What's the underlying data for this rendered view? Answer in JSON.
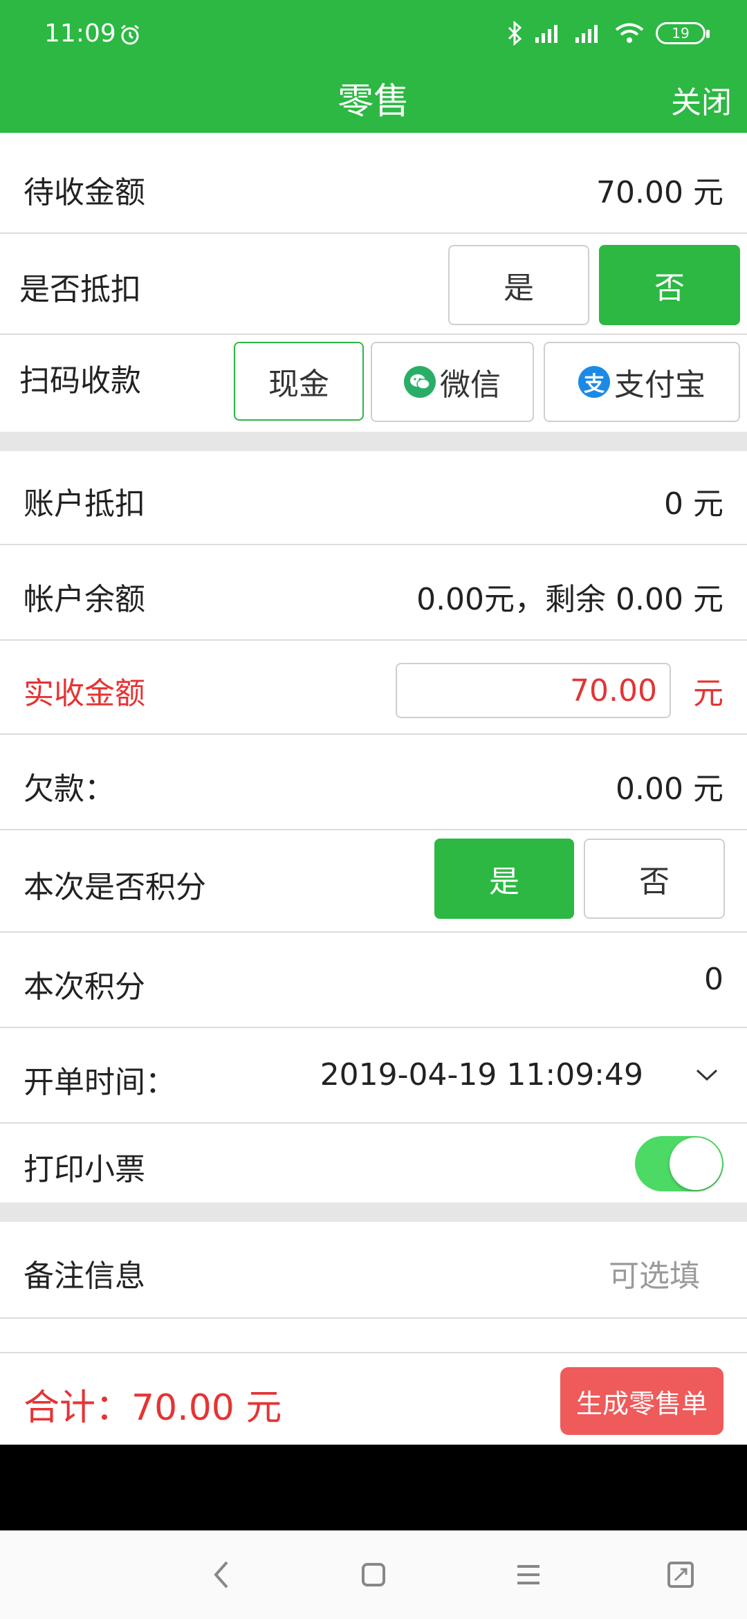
{
  "status_bar": {
    "time": "11:09",
    "battery": "19"
  },
  "header": {
    "title": "零售",
    "close": "关闭"
  },
  "rows": {
    "pending_amount": {
      "label": "待收金额",
      "value": "70.00 元"
    },
    "deduct_choice": {
      "label": "是否抵扣",
      "yes": "是",
      "no": "否",
      "selected": "否"
    },
    "scan_payment": {
      "label": "扫码收款",
      "cash": "现金",
      "wechat": "微信",
      "alipay": "支付宝",
      "selected": "现金"
    },
    "account_deduct": {
      "label": "账户抵扣",
      "value": "0 元"
    },
    "account_balance": {
      "label": "帐户余额",
      "value": "0.00元，剩余 0.00 元"
    },
    "actual_amount": {
      "label": "实收金额",
      "input_value": "70.00",
      "unit": "元"
    },
    "debt": {
      "label": "欠款：",
      "value": "0.00 元"
    },
    "points_choice": {
      "label": "本次是否积分",
      "yes": "是",
      "no": "否",
      "selected": "是"
    },
    "points": {
      "label": "本次积分",
      "value": "0"
    },
    "order_time": {
      "label": "开单时间：",
      "value": "2019-04-19 11:09:49"
    },
    "print_receipt": {
      "label": "打印小票",
      "enabled": true
    },
    "remark": {
      "label": "备注信息",
      "placeholder": "可选填"
    }
  },
  "footer": {
    "total": "合计：70.00 元",
    "submit": "生成零售单"
  },
  "colors": {
    "primary_green": "#2cb843",
    "accent_red": "#e53434",
    "button_red": "#ef5a5a",
    "toggle_green": "#4cd964"
  },
  "icons": [
    "alarm-icon",
    "bluetooth-icon",
    "signal-icon",
    "wifi-icon",
    "wechat-icon",
    "alipay-icon",
    "chevron-down-icon",
    "back-icon",
    "home-icon",
    "menu-icon",
    "screenshot-icon"
  ]
}
